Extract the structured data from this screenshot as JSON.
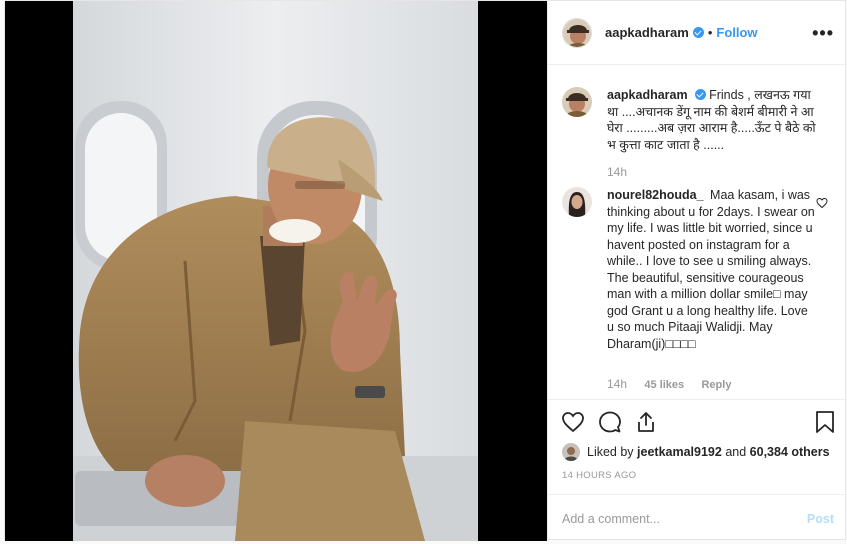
{
  "post": {
    "author": "aapkadharam",
    "follow_label": "Follow",
    "separator": "•",
    "more_label": "•••"
  },
  "caption": {
    "username": "aapkadharam",
    "text": "Frinds , लखनऊ गया था ....अचानक डेंगू नाम की बेशर्म बीमारी ने आ घेरा .........अब ज़रा आराम है.....ऊँट पे बैठे को भ कुत्ता काट जाता है ......",
    "time": "14h"
  },
  "comments": [
    {
      "username": "nourel82houda_",
      "text": "Maa kasam, i was thinking about u for 2days. I swear on my life. I was little bit worried, since u havent posted on instagram for a while.. I love to see u smiling always. The beautiful, sensitive courageous man with a million dollar smile□ may god Grant u a long healthy life. Love u so much Pitaaji Walidji. May Dharam(ji)□□□□",
      "time": "14h",
      "likes": "45 likes",
      "reply": "Reply"
    }
  ],
  "likes": {
    "prefix": "Liked by",
    "user": "jeetkamal9192",
    "and": "and",
    "others": "60,384 others"
  },
  "timestamp": "14 HOURS AGO",
  "add_comment": {
    "placeholder": "Add a comment...",
    "post_label": "Post"
  },
  "icons": {
    "like": "heart-icon",
    "comment": "comment-icon",
    "share": "share-icon",
    "save": "bookmark-icon",
    "verified": "verified-badge-icon",
    "more": "more-options-icon"
  },
  "colors": {
    "accent": "#3897f0",
    "post_disabled": "#b2dffc",
    "muted": "#999999",
    "border": "#efefef"
  }
}
